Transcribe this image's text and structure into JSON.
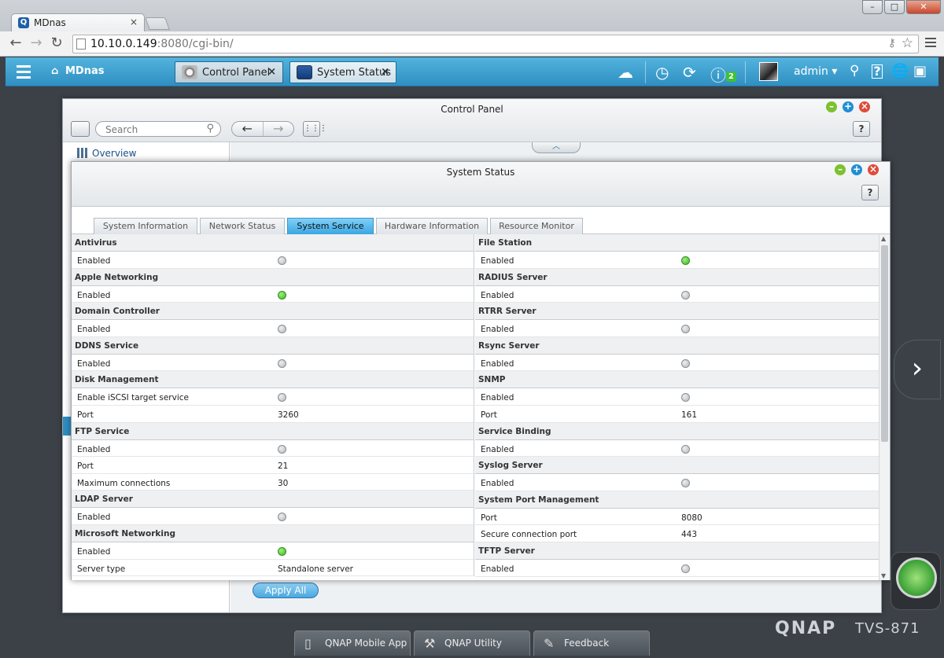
{
  "browser": {
    "tab_title": "MDnas",
    "tab_favicon": "Q",
    "tab_close": "×",
    "url_host": "10.10.0.149",
    "url_rest": ":8080/cgi-bin/",
    "window_min": "–",
    "window_max": "□",
    "window_close": "✕"
  },
  "qts_bar": {
    "home_label": "MDnas",
    "tabs": [
      {
        "label": "Control Panel",
        "close": "×"
      },
      {
        "label": "System Status",
        "close": "×"
      }
    ],
    "notification_count": "2",
    "user": "admin ▾"
  },
  "control_panel": {
    "title": "Control Panel",
    "search_placeholder": "Search",
    "back_arrow": "←",
    "forward_arrow": "→",
    "grid_icon": "⋮⋮⋮",
    "help": "?",
    "sidebar_overview": "Overview",
    "collapse_chevron": "︿",
    "apply_all": "Apply All"
  },
  "system_status": {
    "title": "System Status",
    "help": "?",
    "tabs": [
      "System Information",
      "Network Status",
      "System Service",
      "Hardware Information",
      "Resource Monitor"
    ],
    "active_tab": "System Service",
    "left_groups": [
      {
        "name": "Antivirus",
        "rows": [
          {
            "label": "Enabled",
            "status": "off"
          }
        ]
      },
      {
        "name": "Apple Networking",
        "rows": [
          {
            "label": "Enabled",
            "status": "on"
          }
        ]
      },
      {
        "name": "Domain Controller",
        "rows": [
          {
            "label": "Enabled",
            "status": "off"
          }
        ]
      },
      {
        "name": "DDNS Service",
        "rows": [
          {
            "label": "Enabled",
            "status": "off"
          }
        ]
      },
      {
        "name": "Disk Management",
        "rows": [
          {
            "label": "Enable iSCSI target service",
            "status": "off"
          },
          {
            "label": "Port",
            "value": "3260"
          }
        ]
      },
      {
        "name": "FTP Service",
        "rows": [
          {
            "label": "Enabled",
            "status": "off"
          },
          {
            "label": "Port",
            "value": "21"
          },
          {
            "label": "Maximum connections",
            "value": "30"
          }
        ]
      },
      {
        "name": "LDAP Server",
        "rows": [
          {
            "label": "Enabled",
            "status": "off"
          }
        ]
      },
      {
        "name": "Microsoft Networking",
        "rows": [
          {
            "label": "Enabled",
            "status": "on"
          },
          {
            "label": "Server type",
            "value": "Standalone server"
          }
        ]
      }
    ],
    "right_groups": [
      {
        "name": "File Station",
        "rows": [
          {
            "label": "Enabled",
            "status": "on"
          }
        ]
      },
      {
        "name": "RADIUS Server",
        "rows": [
          {
            "label": "Enabled",
            "status": "off"
          }
        ]
      },
      {
        "name": "RTRR Server",
        "rows": [
          {
            "label": "Enabled",
            "status": "off"
          }
        ]
      },
      {
        "name": "Rsync Server",
        "rows": [
          {
            "label": "Enabled",
            "status": "off"
          }
        ]
      },
      {
        "name": "SNMP",
        "rows": [
          {
            "label": "Enabled",
            "status": "off"
          },
          {
            "label": "Port",
            "value": "161"
          }
        ]
      },
      {
        "name": "Service Binding",
        "rows": [
          {
            "label": "Enabled",
            "status": "off"
          }
        ]
      },
      {
        "name": "Syslog Server",
        "rows": [
          {
            "label": "Enabled",
            "status": "off"
          }
        ]
      },
      {
        "name": "System Port Management",
        "rows": [
          {
            "label": "Port",
            "value": "8080"
          },
          {
            "label": "Secure connection port",
            "value": "443"
          }
        ]
      },
      {
        "name": "TFTP Server",
        "rows": [
          {
            "label": "Enabled",
            "status": "off"
          }
        ]
      }
    ]
  },
  "desktop": {
    "next_arrow": "›",
    "brand": "QNAP",
    "model": "TVS-871",
    "bottom_tabs": [
      {
        "label": "QNAP Mobile App",
        "icon": "phone-icon"
      },
      {
        "label": "QNAP Utility",
        "icon": "hammer-icon"
      },
      {
        "label": "Feedback",
        "icon": "edit-icon"
      }
    ]
  },
  "colors": {
    "qts_bar": "#3aa0d3",
    "active_tab": "#3aa7e2",
    "status_on": "#3cb825",
    "status_off": "#b5b8bb"
  }
}
